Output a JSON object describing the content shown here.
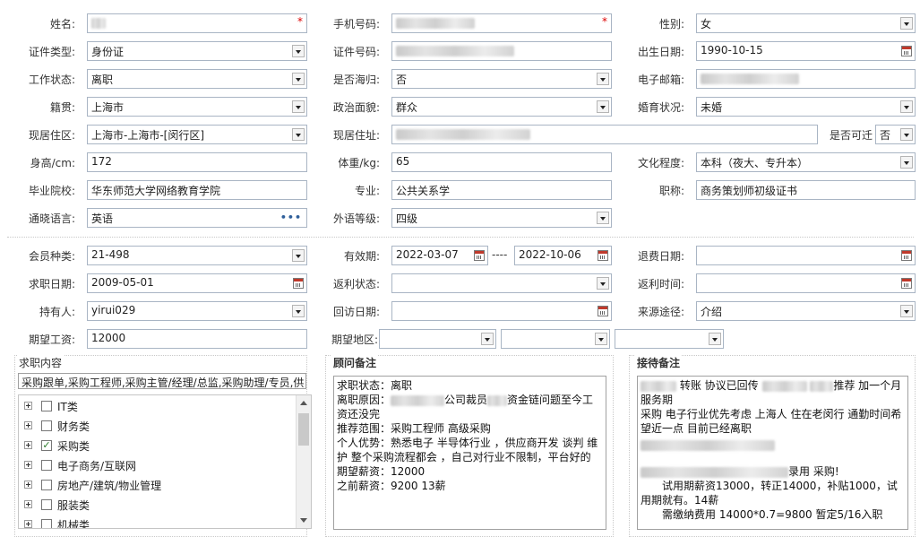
{
  "personal": {
    "name_label": "姓名:",
    "phone_label": "手机号码:",
    "gender_label": "性别:",
    "gender": "女",
    "idtype_label": "证件类型:",
    "idtype": "身份证",
    "idno_label": "证件号码:",
    "birth_label": "出生日期:",
    "birth": "1990-10-15",
    "work_label": "工作状态:",
    "work": "离职",
    "returnee_label": "是否海归:",
    "returnee": "否",
    "email_label": "电子邮箱:",
    "native_label": "籍贯:",
    "native": "上海市",
    "political_label": "政治面貌:",
    "political": "群众",
    "marital_label": "婚育状况:",
    "marital": "未婚",
    "residence_label": "现居住区:",
    "residence": "上海市-上海市-[闵行区]",
    "address_label": "现居住址:",
    "relocate_label": "是否可迁",
    "relocate": "否",
    "height_label": "身高/cm:",
    "height": "172",
    "weight_label": "体重/kg:",
    "weight": "65",
    "education_label": "文化程度:",
    "education": "本科（夜大、专升本）",
    "school_label": "毕业院校:",
    "school": "华东师范大学网络教育学院",
    "major_label": "专业:",
    "major": "公共关系学",
    "title_label": "职称:",
    "title": "商务策划师初级证书",
    "language_label": "通晓语言:",
    "language": "英语",
    "foreign_label": "外语等级:",
    "foreign": "四级"
  },
  "membership": {
    "type_label": "会员种类:",
    "type": "21-498",
    "valid_label": "有效期:",
    "valid_from": "2022-03-07",
    "valid_sep": "----",
    "valid_to": "2022-10-06",
    "refund_label": "退费日期:",
    "seek_label": "求职日期:",
    "seek": "2009-05-01",
    "rebate_status_label": "返利状态:",
    "rebate_time_label": "返利时间:",
    "holder_label": "持有人:",
    "holder": "yirui029",
    "revisit_label": "回访日期:",
    "source_label": "来源途径:",
    "source": "介绍",
    "salary_label": "期望工资:",
    "salary": "12000",
    "region_label": "期望地区:"
  },
  "job_panel": {
    "title": "求职内容",
    "summary": "采购跟单,采购工程师,采购主管/经理/总监,采购助理/专员,供",
    "items": [
      {
        "label": "IT类",
        "checked": ""
      },
      {
        "label": "财务类",
        "checked": ""
      },
      {
        "label": "采购类",
        "checked": "✓"
      },
      {
        "label": "电子商务/互联网",
        "checked": ""
      },
      {
        "label": "房地产/建筑/物业管理",
        "checked": ""
      },
      {
        "label": "服装类",
        "checked": ""
      },
      {
        "label": "机械类",
        "checked": ""
      }
    ]
  },
  "consultant_panel": {
    "title": "顾问备注",
    "line1": "求职状态：离职",
    "line2a": "离职原因：",
    "line2b": "公司裁员",
    "line2c": "资金链问题至今工资还没完",
    "line3": "推荐范围：采购工程师 高级采购",
    "line4": "个人优势：熟悉电子 半导体行业 ，供应商开发 谈判 维护 整个采购流程都会 ，自己对行业不限制，平台好的",
    "line5": "期望薪资：12000",
    "line6": "之前薪资：9200 13薪"
  },
  "reception_panel": {
    "title": "接待备注",
    "line1a": "转账",
    "line1b": "协议已回传",
    "line1c": "推荐 加一个月服务期",
    "line2": "采购 电子行业优先考虑 上海人 住在老闵行 通勤时间希望近一点 目前已经离职",
    "line3": "录用 采购!",
    "line4": "试用期薪资13000，转正14000，补贴1000，试用期就有。14薪",
    "line5": "需缴纳费用 14000*0.7=9800 暂定5/16入职"
  }
}
